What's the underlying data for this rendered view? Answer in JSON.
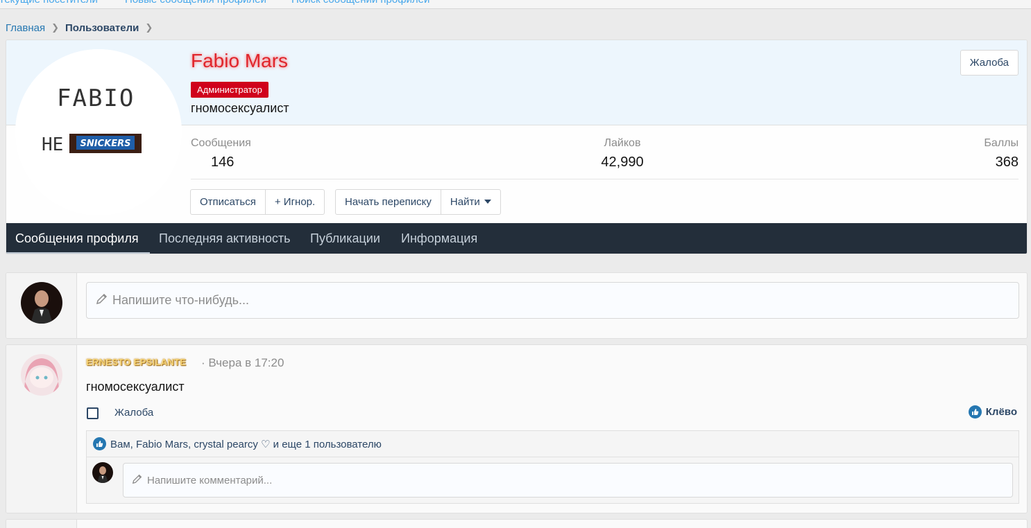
{
  "top_nav": {
    "items": [
      "Текущие посетители",
      "Новые сообщения профилей",
      "Поиск сообщений профилей"
    ]
  },
  "breadcrumb": {
    "home": "Главная",
    "members": "Пользователи"
  },
  "profile": {
    "username": "Fabio Mars",
    "role_badge": "Администратор",
    "user_title": "гномосексуалист",
    "report_label": "Жалоба",
    "avatar_text": {
      "line1": "FABIO",
      "line2": "НЕ",
      "brand": "SNICKERS"
    },
    "stats": [
      {
        "label": "Сообщения",
        "value": "146"
      },
      {
        "label": "Лайков",
        "value": "42,990"
      },
      {
        "label": "Баллы",
        "value": "368"
      }
    ],
    "buttons": {
      "unfollow": "Отписаться",
      "ignore": "+ Игнор.",
      "start_conversation": "Начать переписку",
      "find": "Найти"
    }
  },
  "tabs": [
    {
      "label": "Сообщения профиля",
      "active": true
    },
    {
      "label": "Последняя активность",
      "active": false
    },
    {
      "label": "Публикации",
      "active": false
    },
    {
      "label": "Информация",
      "active": false
    }
  ],
  "composer": {
    "placeholder": "Напишите что-нибудь..."
  },
  "post": {
    "author": "ERNESTO EPSILANTE",
    "separator": "·",
    "time": "Вчера в 17:20",
    "text": "гномосексуалист",
    "report_label": "Жалоба",
    "like_label": "Клёво",
    "reactions_text": "Вам, Fabio Mars, crystal pearcy ♡ и еще 1 пользователю",
    "comment_placeholder": "Напишите комментарий..."
  },
  "colors": {
    "username": "#e0252c",
    "role_badge_bg": "#d0021b",
    "tab_bar": "#232e3a",
    "link": "#2c4766",
    "accent": "#2577b1"
  },
  "icons": [
    "chevron-right-icon",
    "pencil-icon",
    "chevron-down-icon",
    "like-thumb-icon",
    "checkbox-icon"
  ]
}
